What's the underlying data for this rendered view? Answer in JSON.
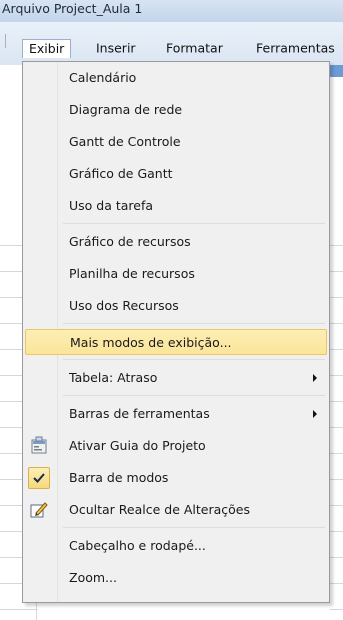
{
  "window": {
    "title": "Arquivo Project_Aula 1"
  },
  "menubar": {
    "items": [
      {
        "label": "Exibir"
      },
      {
        "label": "Inserir"
      },
      {
        "label": "Formatar"
      },
      {
        "label": "Ferramentas"
      }
    ]
  },
  "menu": {
    "items": [
      {
        "label": "Calendário"
      },
      {
        "label": "Diagrama de rede"
      },
      {
        "label": "Gantt de Controle"
      },
      {
        "label": "Gráfico de Gantt"
      },
      {
        "label": "Uso da tarefa"
      },
      {
        "label": "Gráfico de recursos"
      },
      {
        "label": "Planilha de recursos"
      },
      {
        "label": "Uso dos Recursos"
      },
      {
        "label": "Mais modos de exibição...",
        "highlighted": true
      },
      {
        "label": "Tabela: Atraso",
        "submenu": true
      },
      {
        "label": "Barras de ferramentas",
        "submenu": true
      },
      {
        "label": "Ativar Guia do Projeto",
        "icon": "guide-icon"
      },
      {
        "label": "Barra de modos",
        "checked": true
      },
      {
        "label": "Ocultar Realce de Alterações",
        "icon": "highlight-pen-icon"
      },
      {
        "label": "Cabeçalho e rodapé..."
      },
      {
        "label": "Zoom..."
      }
    ]
  },
  "colors": {
    "highlight": "#fbe59a",
    "menu_background": "#f0f0f0"
  }
}
